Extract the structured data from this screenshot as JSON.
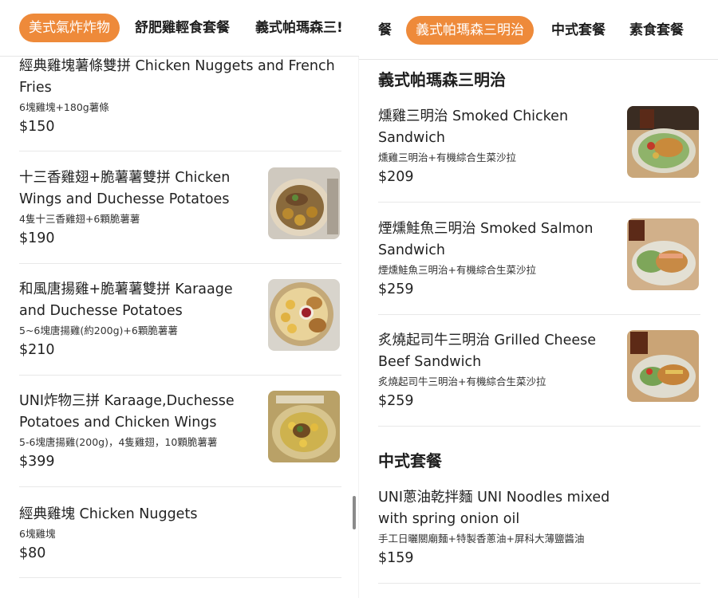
{
  "left": {
    "tabs": [
      {
        "label": "美式氣炸炸物",
        "active": true
      },
      {
        "label": "舒肥雞輕食套餐",
        "active": false
      },
      {
        "label": "義式帕瑪森三!",
        "active": false
      }
    ],
    "items": [
      {
        "name": "經典雞塊薯條雙拼 Chicken Nuggets and French Fries",
        "desc": "6塊雞塊+180g薯條",
        "price": "$150"
      },
      {
        "name": "十三香雞翅+脆薯薯雙拼 Chicken Wings and Duchesse Potatoes",
        "desc": "4隻十三香雞翅+6顆脆薯薯",
        "price": "$190"
      },
      {
        "name": "和風唐揚雞+脆薯薯雙拼 Karaage and Duchesse Potatoes",
        "desc": "5~6塊唐揚雞(約200g)+6顆脆薯薯",
        "price": "$210"
      },
      {
        "name": "UNI炸物三拼 Karaage,Duchesse Potatoes and Chicken Wings",
        "desc": "5-6塊唐揚雞(200g)，4隻雞翅，10顆脆薯薯",
        "price": "$399"
      },
      {
        "name": "經典雞塊 Chicken Nuggets",
        "desc": "6塊雞塊",
        "price": "$80"
      }
    ]
  },
  "right": {
    "tabs": [
      {
        "label": "餐",
        "active": false
      },
      {
        "label": "義式帕瑪森三明治",
        "active": true
      },
      {
        "label": "中式套餐",
        "active": false
      },
      {
        "label": "素食套餐",
        "active": false
      }
    ],
    "section1": "義式帕瑪森三明治",
    "items": [
      {
        "name": "燻雞三明治 Smoked Chicken Sandwich",
        "desc": "燻雞三明治+有機綜合生菜沙拉",
        "price": "$209"
      },
      {
        "name": "煙燻鮭魚三明治 Smoked Salmon Sandwich",
        "desc": "煙燻鮭魚三明治+有機綜合生菜沙拉",
        "price": "$259"
      },
      {
        "name": "炙燒起司牛三明治 Grilled Cheese Beef Sandwich",
        "desc": "炙燒起司牛三明治+有機綜合生菜沙拉",
        "price": "$259"
      }
    ],
    "section2": "中式套餐",
    "items2": [
      {
        "name": "UNI蔥油乾拌麵 UNI Noodles mixed with spring onion oil",
        "desc": "手工日曬關廟麵+特製香蔥油+屏科大薄鹽醬油",
        "price": "$159"
      }
    ]
  },
  "colors": {
    "accent": "#ee8a3a",
    "divider": "#e8e8e8"
  }
}
